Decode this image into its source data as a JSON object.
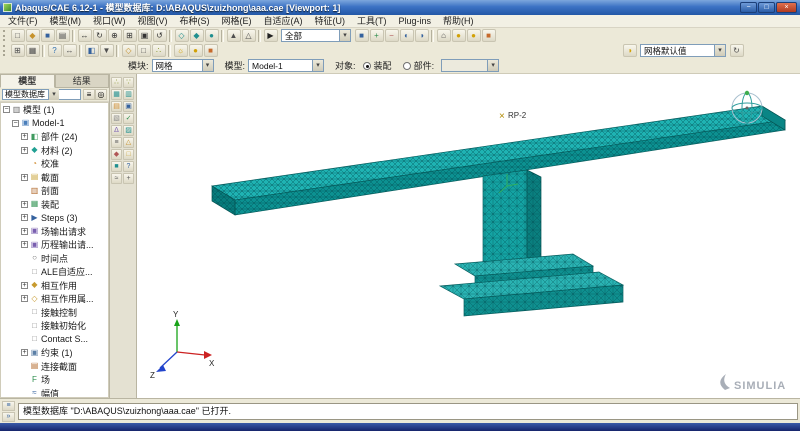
{
  "ui": {
    "combo_arrow": "▾"
  },
  "window": {
    "title": "Abaqus/CAE 6.12-1 - 模型数据库: D:\\ABAQUS\\zuizhong\\aaa.cae  [Viewport: 1]",
    "minimize": "−",
    "maximize": "□",
    "close": "×"
  },
  "menubar": {
    "items": [
      "文件(F)",
      "模型(M)",
      "视口(W)",
      "视图(V)",
      "布种(S)",
      "网格(E)",
      "自适应(A)",
      "特征(U)",
      "工具(T)",
      "Plug-ins",
      "帮助(H)"
    ]
  },
  "toolbar1": {
    "display_group_value": "全部",
    "icons_a": [
      {
        "cls": "tgrip",
        "n": "toolbar-grip",
        "it": "false"
      },
      {
        "n": "new-database-icon",
        "g": "□",
        "c": "#4f4f4f"
      },
      {
        "n": "open-database-icon",
        "g": "◆",
        "c": "#c6922c"
      },
      {
        "n": "save-database-icon",
        "g": "■",
        "c": "#35629e"
      },
      {
        "n": "print-icon",
        "g": "▤",
        "c": "#4f4f4f"
      },
      {
        "cls": "tsep",
        "n": "toolbar-separator",
        "it": "false"
      },
      {
        "n": "pan-view-icon",
        "g": "↔",
        "c": "#333333"
      },
      {
        "n": "rotate-view-icon",
        "g": "↻",
        "c": "#333333"
      },
      {
        "n": "zoom-view-icon",
        "g": "⊕",
        "c": "#333333"
      },
      {
        "n": "box-zoom-icon",
        "g": "⊞",
        "c": "#333333"
      },
      {
        "n": "fit-view-icon",
        "g": "▣",
        "c": "#333333"
      },
      {
        "n": "cycle-views-icon",
        "g": "↺",
        "c": "#333333"
      },
      {
        "cls": "tsep",
        "n": "toolbar-separator",
        "it": "false"
      },
      {
        "n": "wireframe-render-icon",
        "g": "◇",
        "c": "#1f8f8f"
      },
      {
        "n": "hiddenline-render-icon",
        "g": "◆",
        "c": "#1f8f8f"
      },
      {
        "n": "shaded-render-icon",
        "g": "●",
        "c": "#1f8f8f"
      },
      {
        "cls": "tsep",
        "n": "toolbar-separator",
        "it": "false"
      },
      {
        "n": "perspective-on-icon",
        "g": "▲",
        "c": "#4f4f4f"
      },
      {
        "n": "perspective-off-icon",
        "g": "△",
        "c": "#4f4f4f"
      },
      {
        "cls": "tsep",
        "n": "toolbar-separator",
        "it": "false"
      },
      {
        "n": "select-cursor-icon",
        "g": "▶",
        "c": "#222222"
      }
    ],
    "icons_b": [
      {
        "n": "dg-replace-icon",
        "g": "■",
        "c": "#35629e"
      },
      {
        "n": "dg-add-icon",
        "g": "+",
        "c": "#2f8f4f"
      },
      {
        "n": "dg-remove-icon",
        "g": "−",
        "c": "#b05656"
      },
      {
        "n": "dg-intersect-icon",
        "g": "◐",
        "c": "#35629e"
      },
      {
        "n": "dg-either-icon",
        "g": "◑",
        "c": "#35629e"
      },
      {
        "cls": "tsep",
        "n": "toolbar-separator",
        "it": "false"
      },
      {
        "n": "views-toolbar-icon",
        "g": "⌂",
        "c": "#4f4f4f"
      },
      {
        "n": "render-sphere-icon",
        "g": "●",
        "c": "#d2a106"
      },
      {
        "n": "render-sphere2-icon",
        "g": "●",
        "c": "#d2a106"
      },
      {
        "n": "texture-box-icon",
        "g": "■",
        "c": "#c66a2c"
      }
    ]
  },
  "toolbar2": {
    "color_code_value": "网格默认值",
    "icons_a": [
      {
        "cls": "tgrip",
        "n": "toolbar-grip",
        "it": "false"
      },
      {
        "n": "create-viewport-icon",
        "g": "⊞",
        "c": "#4f4f4f"
      },
      {
        "n": "tile-viewports-icon",
        "g": "▦",
        "c": "#4f4f4f"
      },
      {
        "cls": "tsep",
        "n": "toolbar-separator",
        "it": "false"
      },
      {
        "n": "query-info-icon",
        "g": "?",
        "c": "#2f6fb0"
      },
      {
        "n": "measure-icon",
        "g": "↔",
        "c": "#4f4f4f"
      },
      {
        "cls": "tsep",
        "n": "toolbar-separator",
        "it": "false"
      },
      {
        "n": "display-group-manager-icon",
        "g": "◧",
        "c": "#35629e"
      },
      {
        "n": "selection-options-icon",
        "g": "▼",
        "c": "#4f4f4f"
      },
      {
        "cls": "tsep",
        "n": "toolbar-separator",
        "it": "false"
      },
      {
        "n": "datum-display-icon",
        "g": "◇",
        "c": "#c6922c"
      },
      {
        "n": "edge-display-icon",
        "g": "□",
        "c": "#4f4f4f"
      },
      {
        "n": "seed-display-icon",
        "g": "∴",
        "c": "#8a9a2f"
      },
      {
        "cls": "tsep",
        "n": "toolbar-separator",
        "it": "false"
      },
      {
        "n": "light-options-icon",
        "g": "☼",
        "c": "#d2a106"
      },
      {
        "n": "material-sphere-icon",
        "g": "●",
        "c": "#d2a106"
      },
      {
        "n": "texture-cube-icon",
        "g": "■",
        "c": "#c66a2c"
      }
    ],
    "icons_right": [
      {
        "n": "color-code-icon",
        "g": "◑",
        "c": "#d2a106"
      }
    ],
    "icons_right2": [
      {
        "n": "color-code-refresh-icon",
        "g": "↻",
        "c": "#4f4f4f"
      }
    ]
  },
  "context_bar": {
    "module_label": "模块:",
    "module_value": "网格",
    "model_label": "模型:",
    "model_value": "Model-1",
    "object_label": "对象:",
    "option_assembly": "装配",
    "option_part": "部件:"
  },
  "tree_panel": {
    "tabs": [
      "模型",
      "结果"
    ],
    "source_combo": "模型数据库",
    "header_icons": [
      {
        "n": "tree-options-icon",
        "g": "≡"
      },
      {
        "n": "tree-search-icon",
        "g": "◎"
      }
    ],
    "items": [
      {
        "label": "模型 (1)",
        "exp": "−",
        "pad": "2px",
        "ig": "▥",
        "ic": "#6b6b6b"
      },
      {
        "label": "Model-1",
        "exp": "−",
        "pad": "11px",
        "ig": "▣",
        "ic": "#4a7ebb"
      },
      {
        "label": "部件 (24)",
        "exp": "+",
        "pad": "20px",
        "ig": "◧",
        "ic": "#3f9b5f"
      },
      {
        "label": "材料 (2)",
        "exp": "+",
        "pad": "20px",
        "ig": "◆",
        "ic": "#21a093"
      },
      {
        "label": "校准",
        "exp": "",
        "pad": "20px",
        "ig": "◔",
        "ic": "#d08a2e"
      },
      {
        "label": "截面",
        "exp": "+",
        "pad": "20px",
        "ig": "▤",
        "ic": "#caa53d"
      },
      {
        "label": "剖面",
        "exp": "",
        "pad": "20px",
        "ig": "▥",
        "ic": "#b36b2e"
      },
      {
        "label": "装配",
        "exp": "+",
        "pad": "20px",
        "ig": "▦",
        "ic": "#3f9b5f"
      },
      {
        "label": "Steps (3)",
        "exp": "+",
        "pad": "20px",
        "ig": "▶",
        "ic": "#35629e"
      },
      {
        "label": "场输出请求",
        "exp": "+",
        "pad": "20px",
        "ig": "▣",
        "ic": "#7a5fb0"
      },
      {
        "label": "历程输出请...",
        "exp": "+",
        "pad": "20px",
        "ig": "▣",
        "ic": "#7a5fb0"
      },
      {
        "label": "时间点",
        "exp": "",
        "pad": "20px",
        "ig": "○",
        "ic": "#6b6b6b"
      },
      {
        "label": "ALE自适应...",
        "exp": "",
        "pad": "20px",
        "ig": "□",
        "ic": "#8a8a8a"
      },
      {
        "label": "相互作用",
        "exp": "+",
        "pad": "20px",
        "ig": "◆",
        "ic": "#c79a2f"
      },
      {
        "label": "相互作用属...",
        "exp": "+",
        "pad": "20px",
        "ig": "◇",
        "ic": "#c79a2f"
      },
      {
        "label": "接触控制",
        "exp": "",
        "pad": "20px",
        "ig": "□",
        "ic": "#8a8a8a"
      },
      {
        "label": "接触初始化",
        "exp": "",
        "pad": "20px",
        "ig": "□",
        "ic": "#8a8a8a"
      },
      {
        "label": "Contact S...",
        "exp": "",
        "pad": "20px",
        "ig": "□",
        "ic": "#8a8a8a"
      },
      {
        "label": "约束 (1)",
        "exp": "+",
        "pad": "20px",
        "ig": "▣",
        "ic": "#5b7fa6"
      },
      {
        "label": "连接截面",
        "exp": "",
        "pad": "20px",
        "ig": "▤",
        "ic": "#b36b2e"
      },
      {
        "label": "场",
        "exp": "",
        "pad": "20px",
        "ig": "F",
        "ic": "#2f8f4f"
      },
      {
        "label": "幅值",
        "exp": "",
        "pad": "20px",
        "ig": "≈",
        "ic": "#35629e"
      }
    ]
  },
  "toolbox": {
    "icons": [
      {
        "n": "seed-part-icon",
        "g": "∴",
        "c": "#8a9a2f"
      },
      {
        "n": "seed-edges-icon",
        "g": "∵",
        "c": "#8a9a2f"
      },
      {
        "n": "mesh-part-icon",
        "g": "▦",
        "c": "#1f8f8f"
      },
      {
        "n": "mesh-region-icon",
        "g": "▥",
        "c": "#1f8f8f"
      },
      {
        "n": "mesh-controls-icon",
        "g": "▤",
        "c": "#d08a2e"
      },
      {
        "n": "element-type-icon",
        "g": "▣",
        "c": "#35629e"
      },
      {
        "n": "delete-mesh-icon",
        "g": "▧",
        "c": "#8a8a8a"
      },
      {
        "n": "verify-mesh-icon",
        "g": "✓",
        "c": "#2f8f4f"
      },
      {
        "n": "edit-mesh-icon",
        "g": "Δ",
        "c": "#7a5fb0"
      },
      {
        "n": "bottom-up-mesh-icon",
        "g": "▨",
        "c": "#1f8f8f"
      },
      {
        "n": "associate-mesh-icon",
        "g": "≡",
        "c": "#5a5a5a"
      },
      {
        "n": "virtual-topology-icon",
        "g": "△",
        "c": "#c6922c"
      },
      {
        "n": "partition-cell-icon",
        "g": "◆",
        "c": "#b05656"
      },
      {
        "n": "datum-icon",
        "g": "□",
        "c": "#caa53d"
      },
      {
        "n": "create-mesh-part-icon",
        "g": "■",
        "c": "#1f8f8f"
      },
      {
        "n": "query-mesh-icon",
        "g": "?",
        "c": "#35629e"
      },
      {
        "n": "display-options-icon",
        "g": "≈",
        "c": "#5a5a5a"
      },
      {
        "n": "tools-icon",
        "g": "+",
        "c": "#5a5a5a"
      }
    ]
  },
  "viewport": {
    "rp_marker": "×",
    "rp_label": "RP-2",
    "triad_x": "X",
    "triad_y": "Y",
    "triad_z": "Z",
    "watermark": "SIMULIA"
  },
  "message_area": {
    "tabs": [
      {
        "n": "message-tab-icon",
        "g": "≡"
      },
      {
        "n": "command-line-tab-icon",
        "g": "»"
      }
    ],
    "text": "模型数据库 \"D:\\ABAQUS\\zuizhong\\aaa.cae\" 已打开."
  },
  "colors": {
    "model_teal": "#0f9f9f",
    "mesh_line": "#02494f",
    "titlebar_blue": "#2f66bd",
    "ui_gray": "#ece9d8",
    "taskbar_navy": "#1c2e63"
  }
}
